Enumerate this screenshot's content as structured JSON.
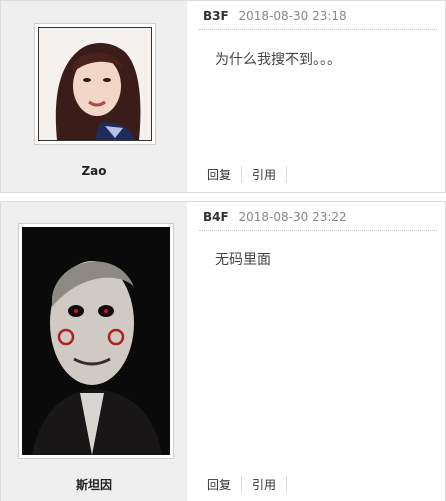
{
  "posts": [
    {
      "floor": "B3F",
      "datetime": "2018-08-30 23:18",
      "username": "Zao",
      "content": "为什么我搜不到。。。",
      "actions": {
        "reply": "回复",
        "quote": "引用"
      }
    },
    {
      "floor": "B4F",
      "datetime": "2018-08-30 23:22",
      "username": "斯坦因",
      "content": "无码里面",
      "actions": {
        "reply": "回复",
        "quote": "引用"
      }
    }
  ]
}
